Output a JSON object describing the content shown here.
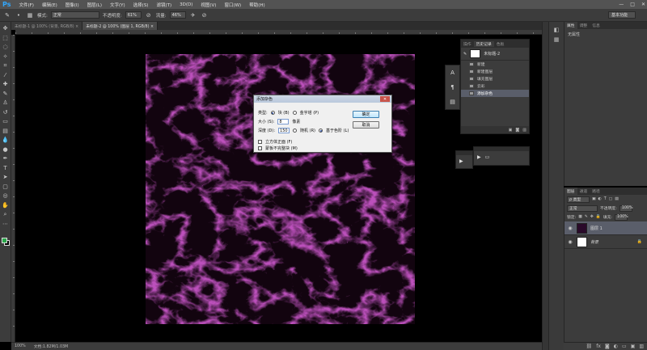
{
  "app": {
    "logo": "Ps",
    "menus": [
      "文件(F)",
      "编辑(E)",
      "图像(I)",
      "图层(L)",
      "文字(Y)",
      "选择(S)",
      "滤镜(T)",
      "3D(D)",
      "视图(V)",
      "窗口(W)",
      "帮助(H)"
    ]
  },
  "window_controls": {
    "minimize": "—",
    "maximize": "□",
    "close": "✕"
  },
  "options": {
    "mode_label": "模式:",
    "mode_value": "正常",
    "opacity_label": "不透明度:",
    "opacity_value": "61%",
    "flow_label": "流量:",
    "flow_value": "46%",
    "workspace": "基本功能"
  },
  "tabs": [
    {
      "label": "未标题-1 @ 100% (背景, RGB/8) ×",
      "active": false
    },
    {
      "label": "未标题-2 @ 100% (图层 1, RGB/8) ×",
      "active": true
    }
  ],
  "status": {
    "zoom": "100%",
    "doc": "文档:1.82M/1.03M"
  },
  "history": {
    "tabs": [
      "操作",
      "历史记录",
      "色板"
    ],
    "snapshot": "未标题-2",
    "items": [
      {
        "label": "新建",
        "active": false
      },
      {
        "label": "新建图层",
        "active": false
      },
      {
        "label": "填充图层",
        "active": false
      },
      {
        "label": "云彩",
        "active": false
      },
      {
        "label": "添加杂色",
        "active": true
      }
    ]
  },
  "properties": {
    "tabs": [
      "属性",
      "调整",
      "信息"
    ],
    "empty_text": "无属性"
  },
  "layers": {
    "tabs": [
      "图层",
      "通道",
      "路径"
    ],
    "kind_label": "ρ 类型",
    "blend_mode": "正常",
    "opacity_label": "不透明度:",
    "opacity_value": "100%",
    "lock_label": "锁定:",
    "fill_label": "填充:",
    "fill_value": "100%",
    "list": [
      {
        "name": "图层 1",
        "selected": true,
        "thumb": "#2a0a2a"
      },
      {
        "name": "背景",
        "selected": false,
        "thumb": "#ffffff"
      }
    ]
  },
  "dialog": {
    "title": "添加杂色",
    "close": "✕",
    "type_label": "类型:",
    "radio_block": "块 (B)",
    "radio_strand": "金字塔 (P)",
    "size_label": "大小 (S):",
    "size_value": "8",
    "size_unit": "像素",
    "depth_label": "深度 (D):",
    "depth_value": "150",
    "radio_random": "随机 (R)",
    "radio_level": "基于色阶 (L)",
    "check_solid": "立方体正面 (F)",
    "check_mask": "蒙板不完整块 (M)",
    "ok": "确定",
    "cancel": "取消"
  }
}
